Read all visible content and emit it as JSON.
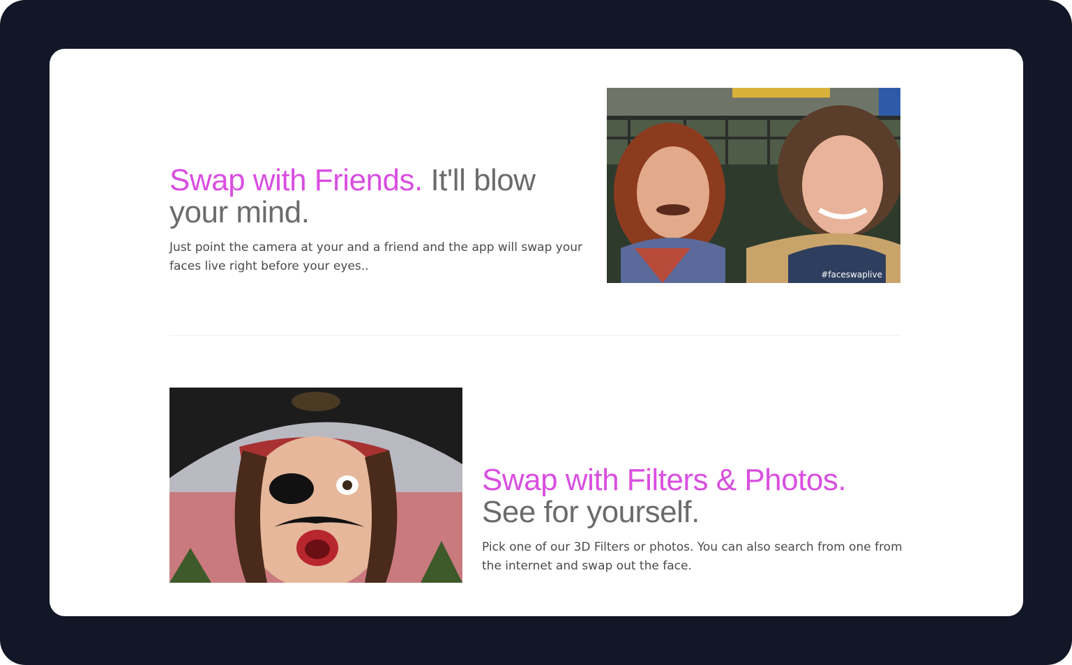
{
  "section_friends": {
    "headline_accent": "Swap with Friends.",
    "headline_rest": "It'll blow your mind.",
    "body": "Just point the camera at your and a friend and the app will swap your faces live right before your eyes..",
    "image_hashtag": "#faceswaplive"
  },
  "section_filters": {
    "headline_accent": "Swap with Filters & Photos.",
    "headline_rest": "See for yourself.",
    "body": "Pick one of our 3D Filters or photos. You can also search from one from the internet and swap out the face."
  },
  "colors": {
    "frame": "#121727",
    "accent": "#d94fe0",
    "headline_gray": "#6b6b6b",
    "body_text": "#4a4a4a"
  }
}
